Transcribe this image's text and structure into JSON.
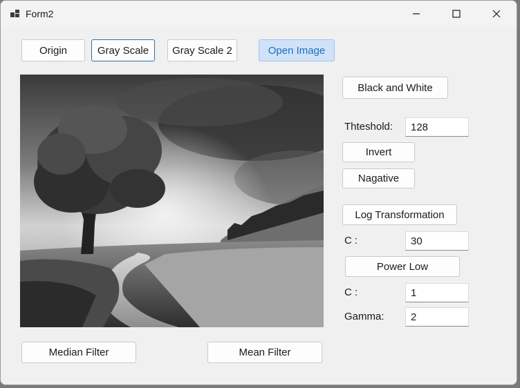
{
  "window": {
    "title": "Form2",
    "icon": "app-form-icon",
    "controls": [
      "minimize-icon",
      "maximize-icon",
      "close-icon"
    ]
  },
  "buttons": {
    "origin": "Origin",
    "gray_scale": "Gray Scale",
    "gray_scale_2": "Gray Scale 2",
    "open_image": "Open Image",
    "black_and_white": "Black and White",
    "invert": "Invert",
    "negative": "Nagative",
    "log_transformation": "Log Transformation",
    "power_low": "Power Low",
    "median_filter": "Median Filter",
    "mean_filter": "Mean Filter"
  },
  "labels": {
    "threshold": "Thteshold:",
    "log_c": "C :",
    "power_c": "C :",
    "gamma": "Gamma:"
  },
  "fields": {
    "threshold": "128",
    "log_c": "30",
    "power_c": "1",
    "gamma": "2"
  },
  "colors": {
    "accent_button_bg": "#cfe2f7",
    "accent_button_text": "#1a6fc0",
    "focus_border": "#2a6fb0"
  }
}
